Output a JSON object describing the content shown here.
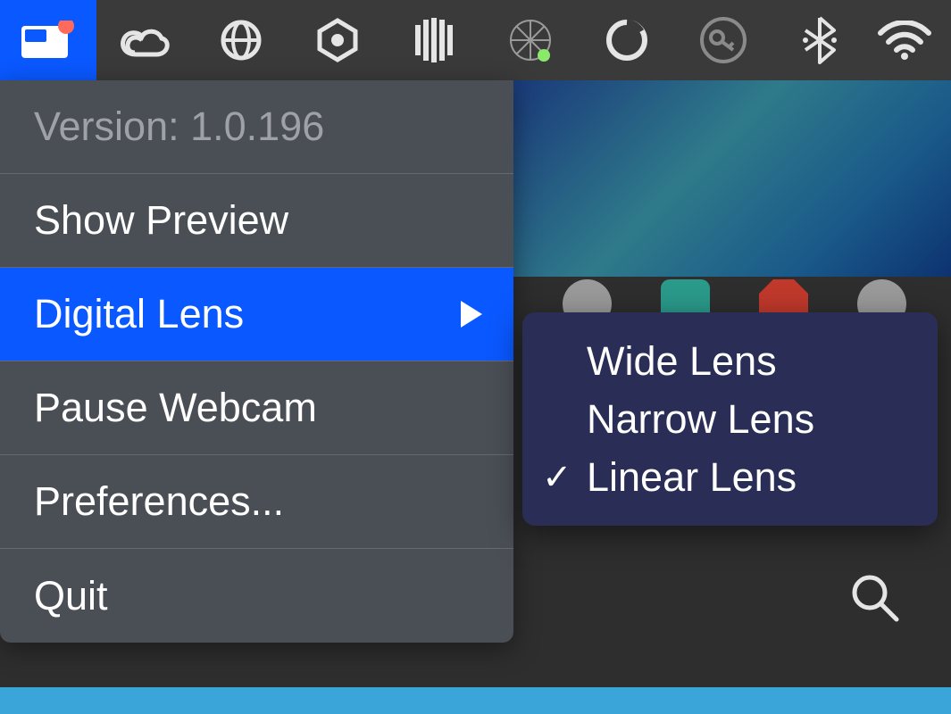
{
  "menubar": {
    "icons": [
      "app-icon",
      "creative-cloud-icon",
      "globe-icon",
      "unity-icon",
      "bars-icon",
      "network-icon",
      "circle-icon",
      "key-icon",
      "bluetooth-icon",
      "wifi-icon"
    ]
  },
  "dropdown": {
    "version_label": "Version: 1.0.196",
    "show_preview": "Show Preview",
    "digital_lens": "Digital Lens",
    "pause_webcam": "Pause Webcam",
    "preferences": "Preferences...",
    "quit": "Quit"
  },
  "submenu": {
    "wide": "Wide Lens",
    "narrow": "Narrow Lens",
    "linear": "Linear Lens",
    "selected": "linear"
  },
  "colors": {
    "highlight": "#0a58ff",
    "menubg": "#4a4e55",
    "submenubg": "#2a2d55"
  }
}
